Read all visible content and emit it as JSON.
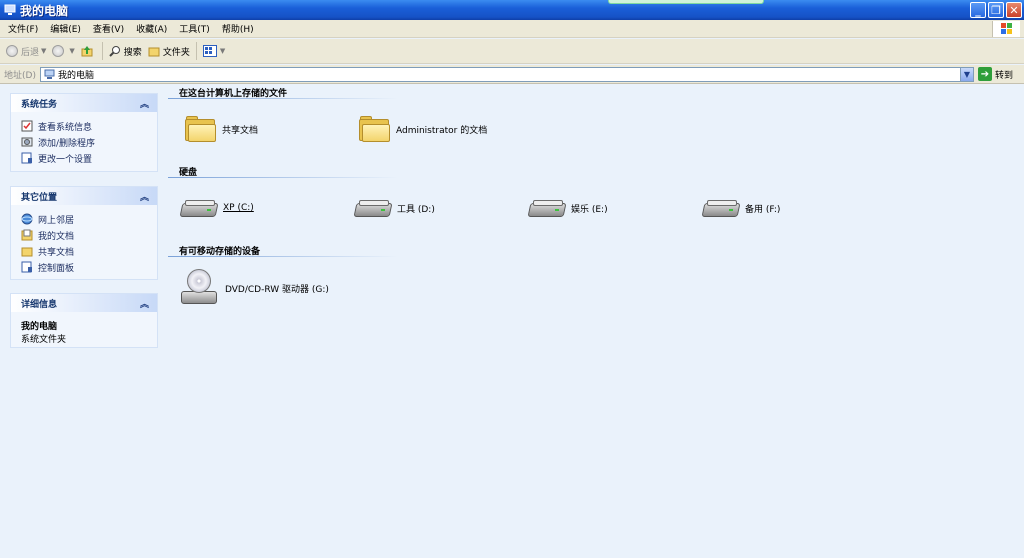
{
  "window": {
    "title": "我的电脑"
  },
  "menu": [
    "文件(F)",
    "编辑(E)",
    "查看(V)",
    "收藏(A)",
    "工具(T)",
    "帮助(H)"
  ],
  "toolbar": {
    "back": "后退",
    "search": "搜索",
    "folders": "文件夹"
  },
  "address": {
    "label": "地址(D)",
    "value": "我的电脑",
    "go": "转到"
  },
  "panes": {
    "system_tasks": {
      "title": "系统任务",
      "items": [
        "查看系统信息",
        "添加/删除程序",
        "更改一个设置"
      ]
    },
    "other_places": {
      "title": "其它位置",
      "items": [
        "网上邻居",
        "我的文档",
        "共享文档",
        "控制面板"
      ]
    },
    "details": {
      "title": "详细信息",
      "name": "我的电脑",
      "type": "系统文件夹"
    }
  },
  "groups": {
    "stored_files": {
      "title": "在这台计算机上存储的文件",
      "items": [
        "共享文档",
        "Administrator 的文档"
      ]
    },
    "hard_disks": {
      "title": "硬盘",
      "items": [
        "XP (C:)",
        "工具 (D:)",
        "娱乐 (E:)",
        "备用 (F:)"
      ]
    },
    "removable": {
      "title": "有可移动存储的设备",
      "items": [
        "DVD/CD-RW 驱动器 (G:)"
      ]
    }
  },
  "colors": {
    "titlebar": "#1652c6",
    "background": "#eaf2fb",
    "folder": "#e8c34e"
  }
}
